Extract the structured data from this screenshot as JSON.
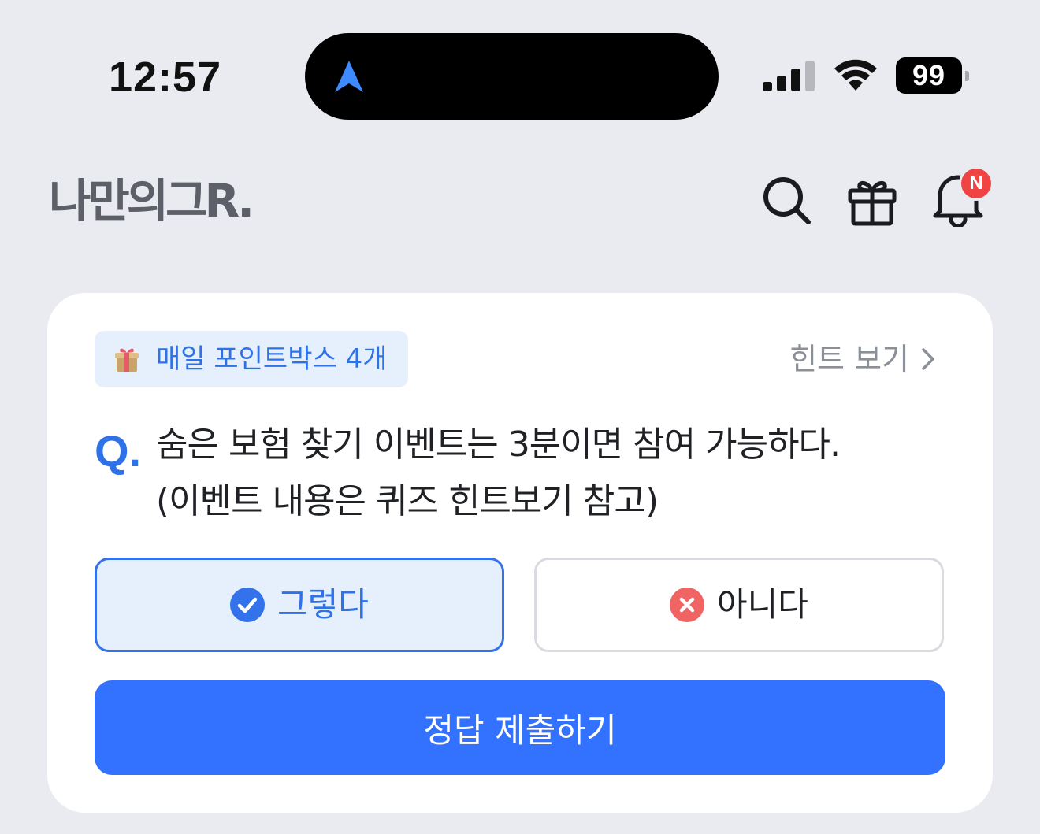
{
  "status_bar": {
    "time": "12:57",
    "battery": "99"
  },
  "header": {
    "logo": "나만의그R.",
    "notification_badge": "N"
  },
  "quiz": {
    "pointbox_label": "매일 포인트박스 4개",
    "hint_label": "힌트 보기",
    "q_mark": "Q.",
    "question_line1": "숨은 보험 찾기 이벤트는 3분이면 참여 가능하다.",
    "question_line2": "(이벤트 내용은 퀴즈 힌트보기 참고)",
    "option_yes": "그렇다",
    "option_no": "아니다",
    "submit_label": "정답 제출하기"
  },
  "colors": {
    "accent": "#3372ff",
    "selected_bg": "#e6f0fd",
    "error": "#f06464",
    "background": "#e9ebf0"
  },
  "icons": [
    "navigation-arrow-icon",
    "signal-icon",
    "wifi-icon",
    "battery-icon",
    "search-icon",
    "gift-icon",
    "bell-icon",
    "gift-box-emoji-icon",
    "chevron-right-icon",
    "check-circle-icon",
    "x-circle-icon"
  ]
}
